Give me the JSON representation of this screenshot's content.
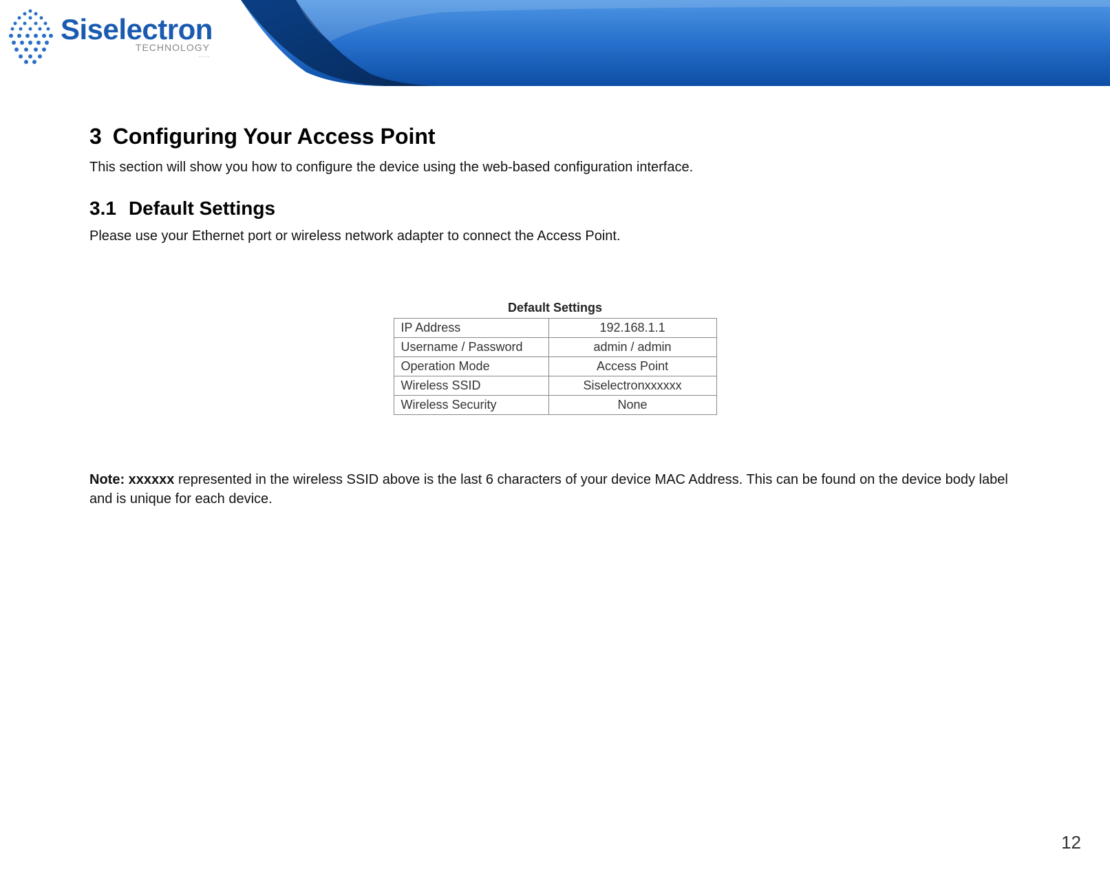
{
  "header": {
    "logo_name": "Siselectron",
    "logo_subtitle": "TECHNOLOGY",
    "logo_tagline": "·····"
  },
  "section": {
    "number": "3",
    "title": "Configuring Your Access Point",
    "intro": "This section will show you how to configure the device using the web-based configuration interface."
  },
  "subsection": {
    "number": "3.1",
    "title": "Default Settings",
    "intro": "Please use your Ethernet port or wireless network adapter to connect the Access Point."
  },
  "table": {
    "caption": "Default Settings",
    "rows": [
      {
        "label": "IP Address",
        "value": "192.168.1.1"
      },
      {
        "label": "Username / Password",
        "value": "admin / admin"
      },
      {
        "label": "Operation Mode",
        "value": "Access Point"
      },
      {
        "label": "Wireless SSID",
        "value": "Siselectronxxxxxx"
      },
      {
        "label": "Wireless Security",
        "value": "None"
      }
    ]
  },
  "note": {
    "prefix": "Note: xxxxxx",
    "text": " represented in the wireless SSID above is the last 6 characters of your device MAC Address. This can be found on the device body label and is unique for each device."
  },
  "page_number": "12"
}
